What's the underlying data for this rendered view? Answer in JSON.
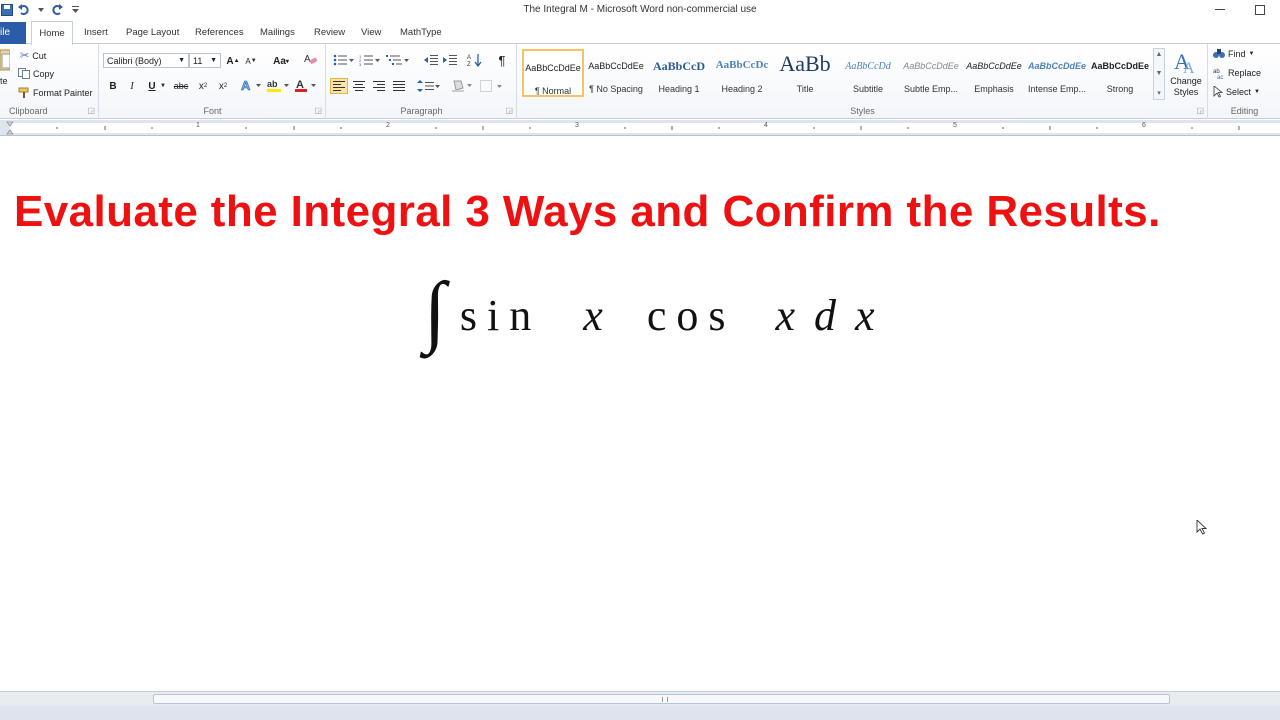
{
  "window": {
    "title": "The Integral M  -  Microsoft Word non-commercial use"
  },
  "tabs": {
    "file": "ile",
    "items": [
      "Home",
      "Insert",
      "Page Layout",
      "References",
      "Mailings",
      "Review",
      "View",
      "MathType"
    ]
  },
  "clipboard": {
    "paste": "te",
    "cut": "Cut",
    "copy": "Copy",
    "format_painter": "Format Painter",
    "label": "Clipboard"
  },
  "font": {
    "name": "Calibri (Body)",
    "size": "11",
    "label": "Font"
  },
  "paragraph": {
    "label": "Paragraph"
  },
  "styles": {
    "label": "Styles",
    "change_styles_line1": "Change",
    "change_styles_line2": "Styles",
    "items": [
      {
        "sample": "AaBbCcDdEe",
        "name": "¶ Normal"
      },
      {
        "sample": "AaBbCcDdEe",
        "name": "¶ No Spacing"
      },
      {
        "sample": "AaBbCcD",
        "name": "Heading 1"
      },
      {
        "sample": "AaBbCcDc",
        "name": "Heading 2"
      },
      {
        "sample": "AaBb",
        "name": "Title"
      },
      {
        "sample": "AaBbCcDd",
        "name": "Subtitle"
      },
      {
        "sample": "AaBbCcDdEe",
        "name": "Subtle Emp..."
      },
      {
        "sample": "AaBbCcDdEe",
        "name": "Emphasis"
      },
      {
        "sample": "AaBbCcDdEe",
        "name": "Intense Emp..."
      },
      {
        "sample": "AaBbCcDdEe",
        "name": "Strong"
      }
    ]
  },
  "editing": {
    "find": "Find",
    "replace": "Replace",
    "select": "Select",
    "label": "Editing"
  },
  "ruler_numbers": [
    "1",
    "2",
    "3",
    "4",
    "5",
    "6"
  ],
  "document": {
    "heading": "Evaluate the Integral 3 Ways and Confirm the Results.",
    "integral": "∫",
    "sin": "sin",
    "x1": "x",
    "cos": "cos",
    "x2": "x",
    "d": "d",
    "x3": "x"
  },
  "colors": {
    "heading": "#ee1111",
    "file_tab": "#2a5ca8",
    "active_style_border": "#f0c562"
  }
}
